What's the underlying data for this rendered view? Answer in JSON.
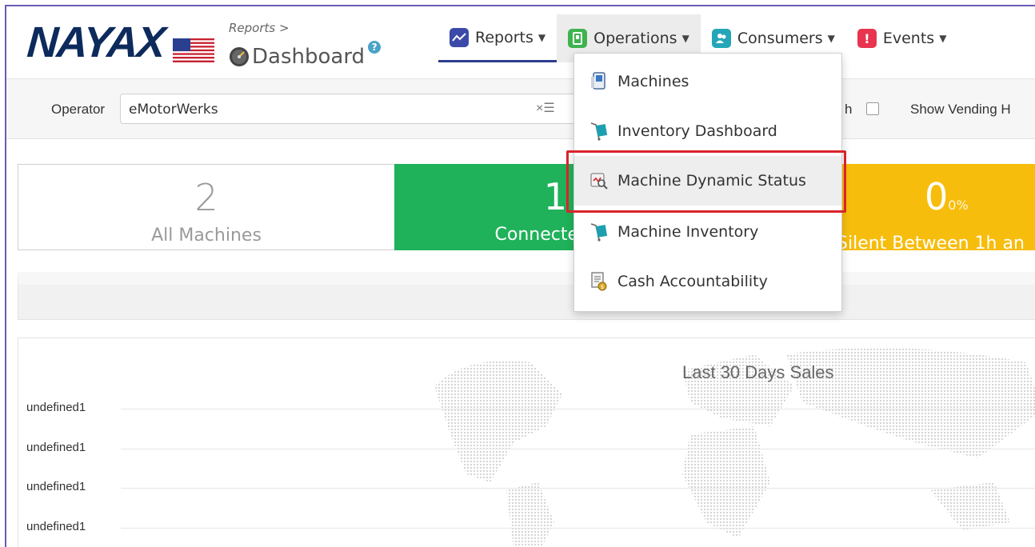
{
  "header": {
    "logo": "NAYAX",
    "breadcrumb": "Reports >",
    "title": "Dashboard",
    "help": "?"
  },
  "nav": {
    "reports": "Reports",
    "operations": "Operations",
    "consumers": "Consumers",
    "events": "Events"
  },
  "filter": {
    "operator_label": "Operator",
    "operator_value": "eMotorWerks",
    "clear_icon": "×☰",
    "refresh_label": "h",
    "show_vending_label": "Show Vending H"
  },
  "tiles": {
    "all": {
      "value": "2",
      "label": "All Machines"
    },
    "connected": {
      "value": "1",
      "label": "Connecte"
    },
    "silent": {
      "value": "0",
      "percent": "0%",
      "label": "Silent Between 1h an"
    }
  },
  "chart": {
    "title": "Last 30 Days Sales",
    "ticks": [
      "undefined1",
      "undefined1",
      "undefined1",
      "undefined1"
    ]
  },
  "dropdown": {
    "items": [
      {
        "label": "Machines",
        "icon": "machines-icon"
      },
      {
        "label": "Inventory Dashboard",
        "icon": "inventory-dashboard-icon"
      },
      {
        "label": "Machine Dynamic Status",
        "icon": "dynamic-status-icon"
      },
      {
        "label": "Machine Inventory",
        "icon": "machine-inventory-icon"
      },
      {
        "label": "Cash Accountability",
        "icon": "cash-accountability-icon"
      }
    ]
  },
  "colors": {
    "connected": "#1fb25a",
    "silent": "#f7bd0d",
    "highlight": "#d9232b",
    "logo": "#0d2a5c"
  }
}
